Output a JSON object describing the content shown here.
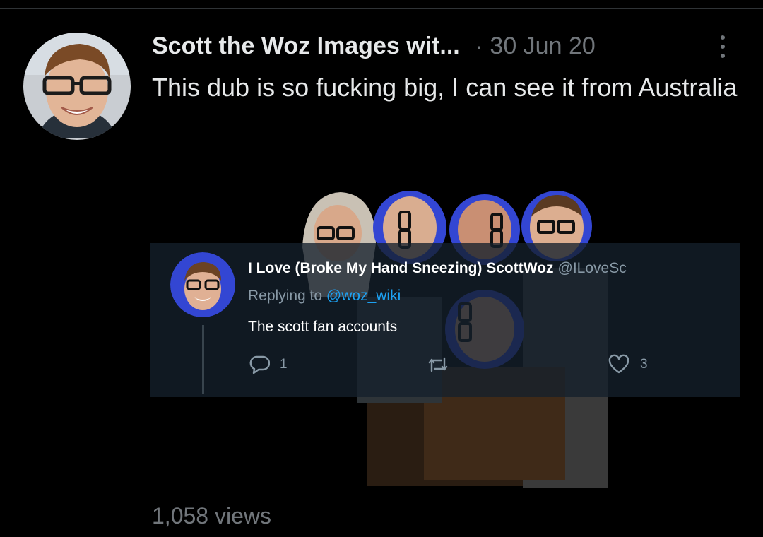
{
  "tweet": {
    "display_name": "Scott the Woz Images wit...",
    "separator": "·",
    "timestamp": "30 Jun 20",
    "text": "This dub is so fucking big, I can see it from Australia",
    "views": "1,058 views"
  },
  "embedded_reply": {
    "display_name": "I Love (Broke My Hand Sneezing) ScottWoz",
    "handle": "@ILoveSc",
    "replying_prefix": "Replying to",
    "replying_to": "@woz_wiki",
    "text": "The scott fan accounts",
    "reply_count": "1",
    "retweet_count": "",
    "like_count": "3"
  },
  "colors": {
    "background": "#000000",
    "primary_text": "#e7e9ea",
    "secondary_text": "#71767b",
    "mention_link": "#1da1f2",
    "avatar_ring": "#3346d3",
    "card_background": "#15202b"
  },
  "icons": [
    "more-vertical-icon",
    "reply-bubble-icon",
    "retweet-icon",
    "heart-icon"
  ]
}
